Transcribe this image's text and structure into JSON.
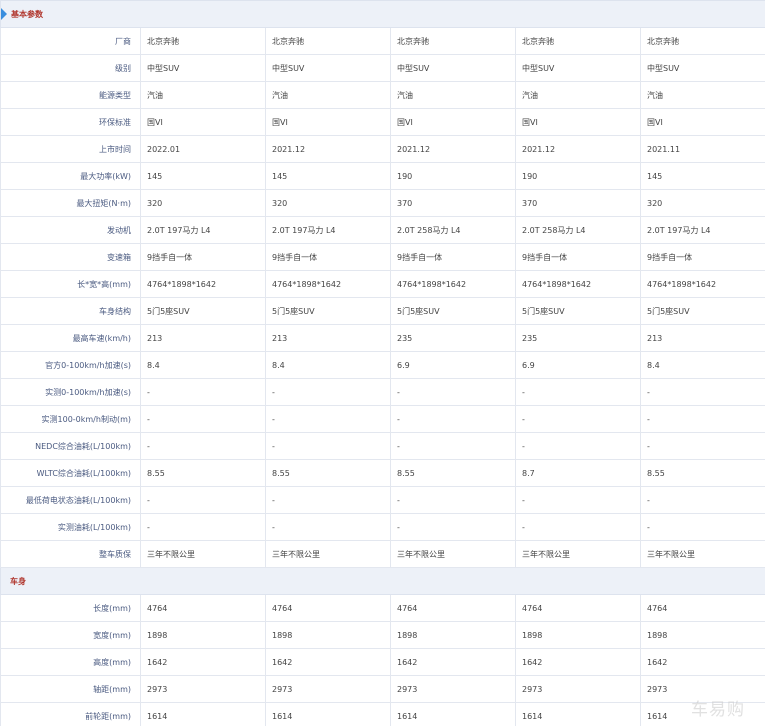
{
  "sections": [
    {
      "title": "基本参数",
      "rows": [
        {
          "label": "厂商",
          "values": [
            "北京奔驰",
            "北京奔驰",
            "北京奔驰",
            "北京奔驰",
            "北京奔驰"
          ]
        },
        {
          "label": "级别",
          "values": [
            "中型SUV",
            "中型SUV",
            "中型SUV",
            "中型SUV",
            "中型SUV"
          ]
        },
        {
          "label": "能源类型",
          "values": [
            "汽油",
            "汽油",
            "汽油",
            "汽油",
            "汽油"
          ]
        },
        {
          "label": "环保标准",
          "values": [
            "国VI",
            "国VI",
            "国VI",
            "国VI",
            "国VI"
          ]
        },
        {
          "label": "上市时间",
          "values": [
            "2022.01",
            "2021.12",
            "2021.12",
            "2021.12",
            "2021.11"
          ]
        },
        {
          "label": "最大功率(kW)",
          "values": [
            "145",
            "145",
            "190",
            "190",
            "145"
          ]
        },
        {
          "label": "最大扭矩(N·m)",
          "values": [
            "320",
            "320",
            "370",
            "370",
            "320"
          ]
        },
        {
          "label": "发动机",
          "values": [
            "2.0T 197马力 L4",
            "2.0T 197马力 L4",
            "2.0T 258马力 L4",
            "2.0T 258马力 L4",
            "2.0T 197马力 L4"
          ]
        },
        {
          "label": "变速箱",
          "values": [
            "9挡手自一体",
            "9挡手自一体",
            "9挡手自一体",
            "9挡手自一体",
            "9挡手自一体"
          ]
        },
        {
          "label": "长*宽*高(mm)",
          "values": [
            "4764*1898*1642",
            "4764*1898*1642",
            "4764*1898*1642",
            "4764*1898*1642",
            "4764*1898*1642"
          ]
        },
        {
          "label": "车身结构",
          "values": [
            "5门5座SUV",
            "5门5座SUV",
            "5门5座SUV",
            "5门5座SUV",
            "5门5座SUV"
          ]
        },
        {
          "label": "最高车速(km/h)",
          "values": [
            "213",
            "213",
            "235",
            "235",
            "213"
          ]
        },
        {
          "label": "官方0-100km/h加速(s)",
          "values": [
            "8.4",
            "8.4",
            "6.9",
            "6.9",
            "8.4"
          ]
        },
        {
          "label": "实测0-100km/h加速(s)",
          "values": [
            "-",
            "-",
            "-",
            "-",
            "-"
          ]
        },
        {
          "label": "实测100-0km/h制动(m)",
          "values": [
            "-",
            "-",
            "-",
            "-",
            "-"
          ]
        },
        {
          "label": "NEDC综合油耗(L/100km)",
          "values": [
            "-",
            "-",
            "-",
            "-",
            "-"
          ]
        },
        {
          "label": "WLTC综合油耗(L/100km)",
          "values": [
            "8.55",
            "8.55",
            "8.55",
            "8.7",
            "8.55"
          ]
        },
        {
          "label": "最低荷电状态油耗(L/100km)",
          "values": [
            "-",
            "-",
            "-",
            "-",
            "-"
          ]
        },
        {
          "label": "实测油耗(L/100km)",
          "values": [
            "-",
            "-",
            "-",
            "-",
            "-"
          ]
        },
        {
          "label": "整车质保",
          "values": [
            "三年不限公里",
            "三年不限公里",
            "三年不限公里",
            "三年不限公里",
            "三年不限公里"
          ]
        }
      ]
    },
    {
      "title": "车身",
      "rows": [
        {
          "label": "长度(mm)",
          "values": [
            "4764",
            "4764",
            "4764",
            "4764",
            "4764"
          ]
        },
        {
          "label": "宽度(mm)",
          "values": [
            "1898",
            "1898",
            "1898",
            "1898",
            "1898"
          ]
        },
        {
          "label": "高度(mm)",
          "values": [
            "1642",
            "1642",
            "1642",
            "1642",
            "1642"
          ]
        },
        {
          "label": "轴距(mm)",
          "values": [
            "2973",
            "2973",
            "2973",
            "2973",
            "2973"
          ]
        },
        {
          "label": "前轮距(mm)",
          "values": [
            "1614",
            "1614",
            "1614",
            "1614",
            "1614"
          ]
        }
      ]
    }
  ],
  "watermark": "车易购"
}
